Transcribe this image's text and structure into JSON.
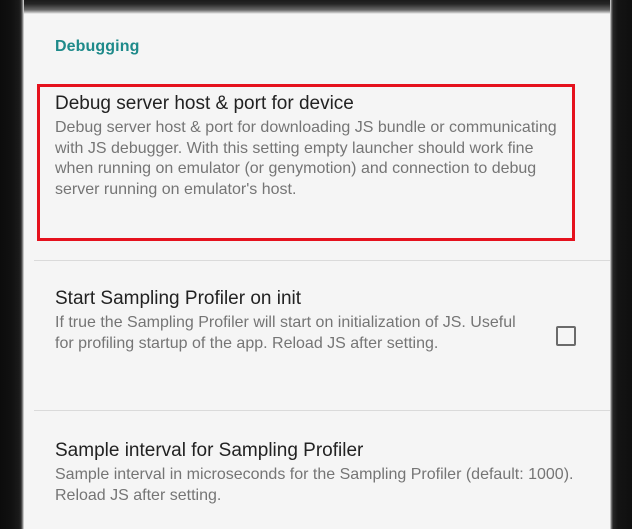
{
  "category": {
    "title": "Debugging"
  },
  "preferences": [
    {
      "title": "Debug server host & port for device",
      "summary": "Debug server host & port for downloading JS bundle or communicating with JS debugger. With this setting empty launcher should work fine when running on emulator (or genymotion) and connection to debug server running on emulator's host."
    },
    {
      "title": "Start Sampling Profiler on init",
      "summary": "If true the Sampling Profiler will start on initialization of JS. Useful for profiling startup of the app. Reload JS after setting.",
      "checked": false
    },
    {
      "title": "Sample interval for Sampling Profiler",
      "summary": "Sample interval in microseconds for the Sampling Profiler (default: 1000). Reload JS after setting."
    }
  ],
  "colors": {
    "category_accent": "#1e8a8a",
    "highlight": "#e5111d",
    "title_text": "#222222",
    "summary_text": "#757575",
    "background": "#f5f5f5"
  }
}
